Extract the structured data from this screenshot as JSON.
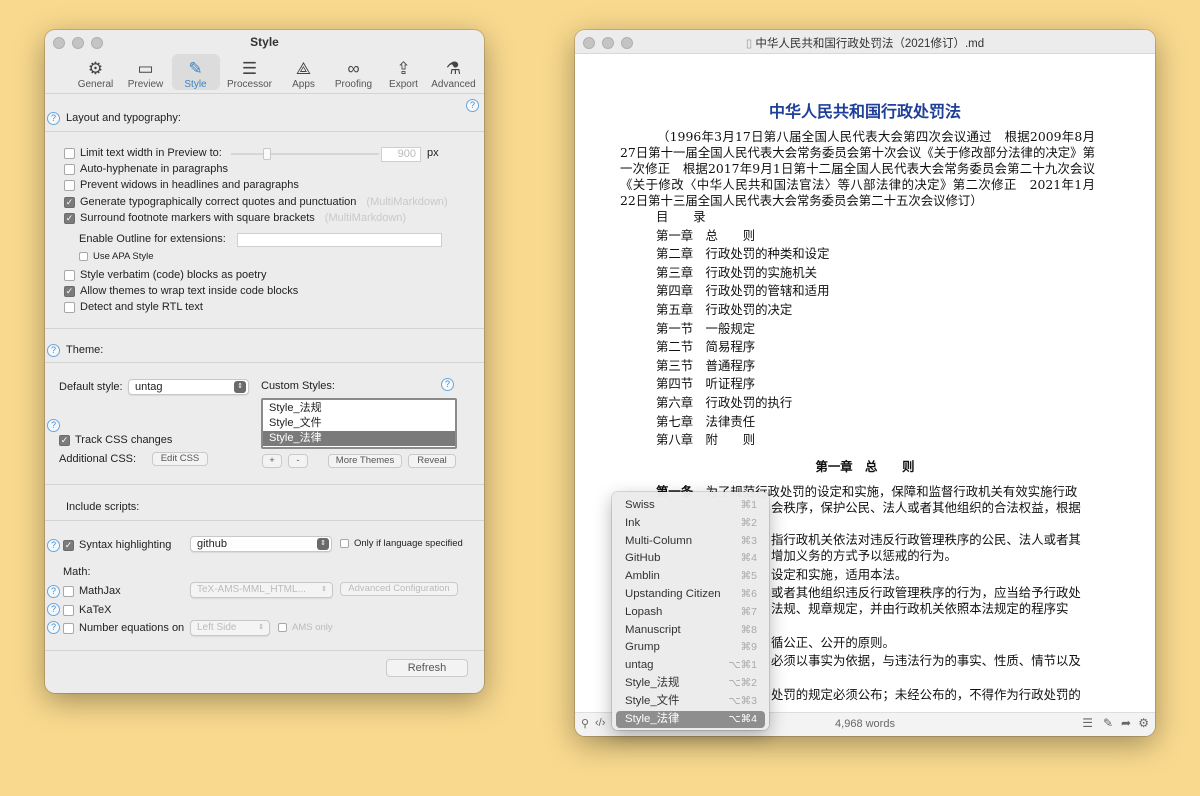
{
  "style_window": {
    "title": "Style",
    "tabs": [
      {
        "label": "General",
        "icon": "gear-icon"
      },
      {
        "label": "Preview",
        "icon": "preview-icon"
      },
      {
        "label": "Style",
        "icon": "style-icon",
        "active": true
      },
      {
        "label": "Processor",
        "icon": "sliders-icon"
      },
      {
        "label": "Apps",
        "icon": "apps-icon"
      },
      {
        "label": "Proofing",
        "icon": "glasses-icon"
      },
      {
        "label": "Export",
        "icon": "export-icon"
      },
      {
        "label": "Advanced",
        "icon": "flask-icon"
      }
    ],
    "layout_heading": "Layout and typography:",
    "opts": {
      "limit_width": "Limit text width in Preview to:",
      "limit_value": "900",
      "limit_unit": "px",
      "auto_hyphen": "Auto-hyphenate in paragraphs",
      "widows": "Prevent widows in headlines and paragraphs",
      "quotes": "Generate typographically correct quotes and punctuation",
      "quotes_hint": "(MultiMarkdown)",
      "footnote": "Surround footnote markers with square brackets",
      "footnote_hint": "(MultiMarkdown)",
      "outline_label": "Enable Outline for extensions:",
      "apa": "Use APA Style",
      "verbatim": "Style verbatim (code) blocks as poetry",
      "wrap": "Allow themes to wrap text inside code blocks",
      "rtl": "Detect and style RTL text"
    },
    "theme_heading": "Theme:",
    "default_style_label": "Default style:",
    "default_style_value": "untag",
    "custom_styles_label": "Custom Styles:",
    "custom_styles": [
      "Style_法规",
      "Style_文件",
      "Style_法律"
    ],
    "track_css": "Track CSS changes",
    "additional_css": "Additional CSS:",
    "edit_css": "Edit CSS",
    "plus": "+",
    "minus": "-",
    "more_themes": "More Themes",
    "reveal": "Reveal",
    "scripts_heading": "Include scripts:",
    "syntax": "Syntax highlighting",
    "syntax_value": "github",
    "only_if": "Only if language specified",
    "math": "Math:",
    "mathjax": "MathJax",
    "mathjax_value": "TeX-AMS-MML_HTML...",
    "adv_config": "Advanced Configuration",
    "katex": "KaTeX",
    "number_eq": "Number equations on",
    "number_eq_value": "Left Side",
    "ams_only": "AMS only",
    "refresh": "Refresh",
    "help": "?"
  },
  "doc_window": {
    "title": "中华人民共和国行政处罚法（2021修订）.md",
    "heading": "中华人民共和国行政处罚法",
    "intro": "（1996年3月17日第八届全国人民代表大会第四次会议通过　根据2009年8月27日第十一届全国人民代表大会常务委员会第十次会议《关于修改部分法律的决定》第一次修正　根据2017年9月1日第十二届全国人民代表大会常务委员会第二十九次会议《关于修改〈中华人民共和国法官法〉等八部法律的决定》第二次修正　2021年1月22日第十三届全国人民代表大会常务委员会第二十五次会议修订）",
    "toc": [
      "目　　录",
      "第一章　总　　则",
      "第二章　行政处罚的种类和设定",
      "第三章　行政处罚的实施机关",
      "第四章　行政处罚的管辖和适用",
      "第五章　行政处罚的决定",
      "第一节　一般规定",
      "第二节　简易程序",
      "第三节　普通程序",
      "第四节　听证程序",
      "第六章　行政处罚的执行",
      "第七章　法律责任",
      "第八章　附　　则"
    ],
    "chapter1": "第一章　总　　则",
    "art1_label": "第一条",
    "art1_l1": "为了规范行政处罚的设定和实施，保障和监督行政机关有效实施行政",
    "art1_l2": "会秩序，保护公民、法人或者其他组织的合法权益，根据",
    "l3": "指行政机关依法对违反行政管理秩序的公民、法人或者其",
    "l4": "增加义务的方式予以惩戒的行为。",
    "l5": "设定和实施，适用本法。",
    "l6": "或者其他组织违反行政管理秩序的行为，应当给予行政处",
    "l7": "法规、规章规定，并由行政机关依照本法规定的程序实",
    "l8": "循公正、公开的原则。",
    "l9": "必须以事实为依据，与违法行为的事实、性质、情节以及",
    "l10": "处罚的规定必须公布；未经公布的，不得作为行政处罚的",
    "word_count": "4,968 words"
  },
  "style_menu": [
    {
      "label": "Swiss",
      "shortcut": "⌘1"
    },
    {
      "label": "Ink",
      "shortcut": "⌘2"
    },
    {
      "label": "Multi-Column",
      "shortcut": "⌘3"
    },
    {
      "label": "GitHub",
      "shortcut": "⌘4"
    },
    {
      "label": "Amblin",
      "shortcut": "⌘5"
    },
    {
      "label": "Upstanding Citizen",
      "shortcut": "⌘6"
    },
    {
      "label": "Lopash",
      "shortcut": "⌘7"
    },
    {
      "label": "Manuscript",
      "shortcut": "⌘8"
    },
    {
      "label": "Grump",
      "shortcut": "⌘9"
    },
    {
      "label": "untag",
      "shortcut": "⌥⌘1"
    },
    {
      "label": "Style_法规",
      "shortcut": "⌥⌘2"
    },
    {
      "label": "Style_文件",
      "shortcut": "⌥⌘3"
    },
    {
      "label": "Style_法律",
      "shortcut": "⌥⌘4",
      "selected": true
    }
  ]
}
